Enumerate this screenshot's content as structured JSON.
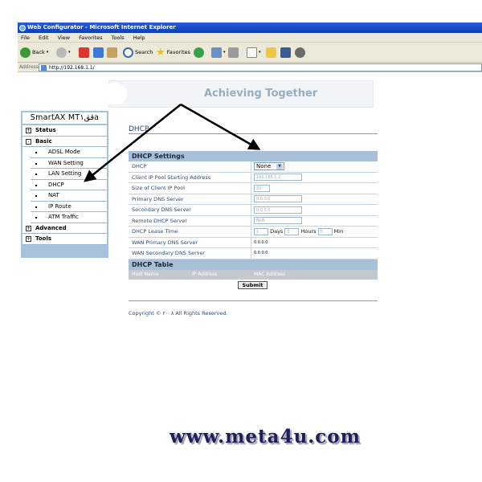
{
  "window": {
    "title": "Web Configurator - Microsoft Internet Explorer"
  },
  "menubar": {
    "items": [
      "File",
      "Edit",
      "View",
      "Favorites",
      "Tools",
      "Help"
    ]
  },
  "toolbar": {
    "back_label": "Back",
    "search_label": "Search",
    "favorites_label": "Favorites"
  },
  "address": {
    "label": "Address",
    "url": "http://192.168.1.1/"
  },
  "banner": {
    "slogan": "Achieving Together"
  },
  "sidebar": {
    "brand": "SmartAX MTڨڨ۱a",
    "items": [
      {
        "label": "Status",
        "type": "group",
        "toggle": "+"
      },
      {
        "label": "Basic",
        "type": "group",
        "toggle": "-"
      },
      {
        "label": "ADSL Mode",
        "type": "sub"
      },
      {
        "label": "WAN Setting",
        "type": "sub"
      },
      {
        "label": "LAN Setting",
        "type": "sub"
      },
      {
        "label": "DHCP",
        "type": "sub"
      },
      {
        "label": "NAT",
        "type": "sub"
      },
      {
        "label": "IP Route",
        "type": "sub"
      },
      {
        "label": "ATM Traffic",
        "type": "sub"
      },
      {
        "label": "Advanced",
        "type": "group",
        "toggle": "+"
      },
      {
        "label": "Tools",
        "type": "group",
        "toggle": "+"
      }
    ]
  },
  "content": {
    "page_title": "DHCP",
    "settings_header": "DHCP Settings",
    "rows": {
      "dhcp": {
        "label": "DHCP",
        "value": "None"
      },
      "pool_start": {
        "label": "Client IP Pool Starting Address",
        "value": "192.168.1.2"
      },
      "pool_size": {
        "label": "Size of Client IP Pool",
        "value": "32"
      },
      "primary_dns": {
        "label": "Primary DNS Server",
        "value": "0.0.0.0"
      },
      "secondary_dns": {
        "label": "Secondary DNS Server",
        "value": "0.0.0.0"
      },
      "remote_dhcp": {
        "label": "Remote DHCP Server",
        "value": "N/A"
      },
      "lease": {
        "label": "DHCP Lease Time",
        "days_value": "1",
        "days_label": "Days",
        "hours_value": "0",
        "hours_label": "Hours",
        "min_value": "0",
        "min_label": "Min"
      },
      "wan_primary_dns": {
        "label": "WAN Primary DNS Server",
        "value": "0.0.0.0"
      },
      "wan_secondary_dns": {
        "label": "WAN Secondary DNS Server",
        "value": "0.0.0.0"
      }
    },
    "table_header": "DHCP Table",
    "table_columns": [
      "Host Name",
      "IP Address",
      "MAC Address"
    ],
    "submit_label": "Submit",
    "copyright": "Copyright © ۲۰۰۸ All Rights Reserved."
  },
  "watermark": "www.meta4u.com"
}
